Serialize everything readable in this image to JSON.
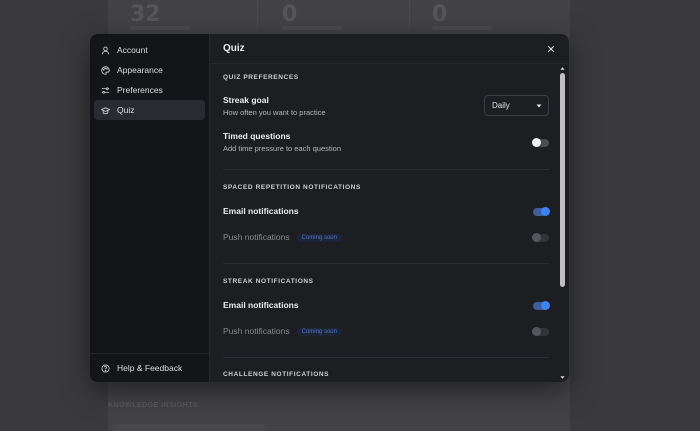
{
  "background": {
    "stats": [
      "32",
      "0",
      "0"
    ],
    "footer_text": "KNOWLEDGE INSIGHTS"
  },
  "sidebar": {
    "items": [
      {
        "label": "Account",
        "icon": "user-icon"
      },
      {
        "label": "Appearance",
        "icon": "palette-icon"
      },
      {
        "label": "Preferences",
        "icon": "sliders-icon"
      },
      {
        "label": "Quiz",
        "icon": "graduation-cap-icon",
        "active": true
      }
    ],
    "help_label": "Help & Feedback"
  },
  "header": {
    "title": "Quiz"
  },
  "quiz_preferences": {
    "section_title": "QUIZ PREFERENCES",
    "streak_goal": {
      "label": "Streak goal",
      "description": "How often you want to practice",
      "value": "Daily"
    },
    "timed_questions": {
      "label": "Timed questions",
      "description": "Add time pressure to each question",
      "enabled": false
    }
  },
  "spaced_repetition": {
    "section_title": "SPACED REPETITION NOTIFICATIONS",
    "email_label": "Email notifications",
    "email_enabled": true,
    "push_label": "Push notifications",
    "push_badge": "Coming soon"
  },
  "streak": {
    "section_title": "STREAK NOTIFICATIONS",
    "email_label": "Email notifications",
    "email_enabled": true,
    "push_label": "Push notifications",
    "push_badge": "Coming soon"
  },
  "challenge": {
    "section_title": "CHALLENGE NOTIFICATIONS"
  },
  "colors": {
    "accent": "#3b82f6",
    "modal_bg": "#1d1e21",
    "sidebar_bg": "#141518"
  }
}
